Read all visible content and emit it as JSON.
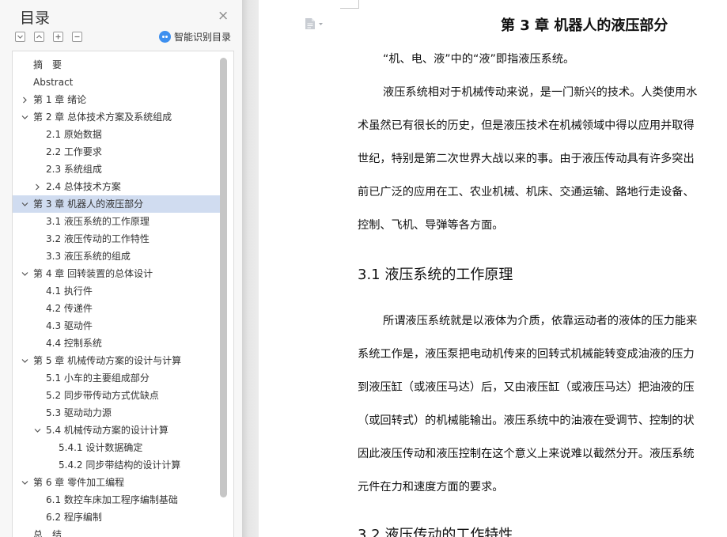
{
  "toc": {
    "title": "目录",
    "close_icon": "×",
    "ai_label": "智能识别目录",
    "toolbar_icons": [
      "collapse-all-icon",
      "collapse-level-icon",
      "expand-icon",
      "shrink-icon"
    ],
    "items": [
      {
        "label": "摘　要",
        "level": 1,
        "arrow": "none"
      },
      {
        "label": "Abstract",
        "level": 1,
        "arrow": "none"
      },
      {
        "label": "第 1 章  绪论",
        "level": 1,
        "arrow": "right"
      },
      {
        "label": "第 2 章  总体技术方案及系统组成",
        "level": 1,
        "arrow": "down"
      },
      {
        "label": "2.1 原始数据",
        "level": 2,
        "arrow": "none"
      },
      {
        "label": "2.2 工作要求",
        "level": 2,
        "arrow": "none"
      },
      {
        "label": "2.3 系统组成",
        "level": 2,
        "arrow": "none"
      },
      {
        "label": "2.4 总体技术方案",
        "level": 2,
        "arrow": "right"
      },
      {
        "label": "第 3 章  机器人的液压部分",
        "level": 1,
        "arrow": "down",
        "active": true
      },
      {
        "label": "3.1 液压系统的工作原理",
        "level": 2,
        "arrow": "none"
      },
      {
        "label": "3.2 液压传动的工作特性",
        "level": 2,
        "arrow": "none"
      },
      {
        "label": "3.3 液压系统的组成",
        "level": 2,
        "arrow": "none"
      },
      {
        "label": "第 4 章  回转装置的总体设计",
        "level": 1,
        "arrow": "down"
      },
      {
        "label": "4.1 执行件",
        "level": 2,
        "arrow": "none"
      },
      {
        "label": "4.2 传递件",
        "level": 2,
        "arrow": "none"
      },
      {
        "label": "4.3 驱动件",
        "level": 2,
        "arrow": "none"
      },
      {
        "label": "4.4 控制系统",
        "level": 2,
        "arrow": "none"
      },
      {
        "label": "第 5 章  机械传动方案的设计与计算",
        "level": 1,
        "arrow": "down"
      },
      {
        "label": "5.1 小车的主要组成部分",
        "level": 2,
        "arrow": "none"
      },
      {
        "label": "5.2 同步带传动方式优缺点",
        "level": 2,
        "arrow": "none"
      },
      {
        "label": "5.3 驱动动力源",
        "level": 2,
        "arrow": "none"
      },
      {
        "label": "5.4 机械传动方案的设计计算",
        "level": 2,
        "arrow": "down"
      },
      {
        "label": "5.4.1 设计数据确定",
        "level": 3,
        "arrow": "none"
      },
      {
        "label": "5.4.2 同步带结构的设计计算",
        "level": 3,
        "arrow": "none"
      },
      {
        "label": "第 6 章  零件加工编程",
        "level": 1,
        "arrow": "down"
      },
      {
        "label": "6.1 数控车床加工程序编制基础",
        "level": 2,
        "arrow": "none"
      },
      {
        "label": "6.2 程序编制",
        "level": 2,
        "arrow": "none"
      },
      {
        "label": "总　结",
        "level": 1,
        "arrow": "none"
      }
    ]
  },
  "document": {
    "chapter_title": "第 3 章  机器人的液压部分",
    "intro": "“机、电、液”中的“液”即指液压系统。",
    "para1_lines": [
      "液压系统相对于机械传动来说，是一门新兴的技术。人类使用水",
      "术虽然已有很长的历史，但是液压技术在机械领域中得以应用并取得",
      "世纪，特别是第二次世界大战以来的事。由于液压传动具有许多突出",
      "前已广泛的应用在工、农业机械、机床、交通运输、路地行走设备、",
      "控制、飞机、导弹等各方面。"
    ],
    "section1_title": "3.1 液压系统的工作原理",
    "para2_lines": [
      "所谓液压系统就是以液体为介质，依靠运动者的液体的压力能来",
      "系统工作是，液压泵把电动机传来的回转式机械能转变成油液的压力",
      "到液压缸（或液压马达）后，又由液压缸（或液压马达）把油液的压",
      "（或回转式）的机械能输出。液压系统中的油液在受调节、控制的状",
      "因此液压传动和液压控制在这个意义上来说难以截然分开。液压系统",
      "元件在力和速度方面的要求。"
    ],
    "section2_title": "3.2 液压传动的工作特性"
  }
}
